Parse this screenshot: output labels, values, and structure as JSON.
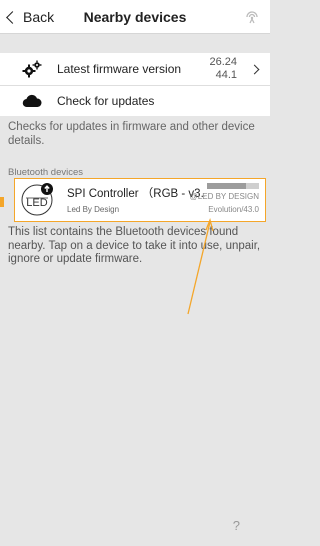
{
  "navbar": {
    "back_label": "Back",
    "title": "Nearby devices",
    "right_icon": "bluetooth-scan-icon"
  },
  "firmware": {
    "latest_label": "Latest firmware version",
    "latest_version_line1": "26.24",
    "latest_version_line2": "44.1",
    "check_label": "Check for updates",
    "help_text": "Checks for updates in firmware and other device details."
  },
  "devices": {
    "section_header": "Bluetooth devices",
    "items": [
      {
        "name": "SPI Controller （RGB - v3...",
        "maker": "Led By Design",
        "brand": "@LED BY DESIGN",
        "firmware": "Evolution/43.0",
        "signal_strength": 0.75,
        "logo_text": "LED"
      }
    ],
    "help_text": "This list contains the Bluetooth devices found nearby. Tap on a device to take it into use, unpair, ignore or update firmware."
  },
  "footer": {
    "help_label": "?"
  },
  "colors": {
    "accent": "#f4a62a",
    "background": "#e6e6e6"
  }
}
